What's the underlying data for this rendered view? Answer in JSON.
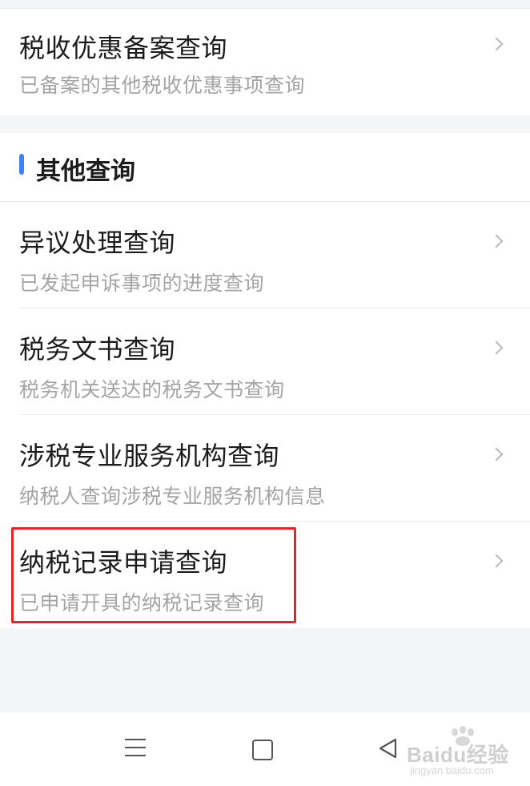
{
  "top_row": {
    "title": "税收优惠备案查询",
    "subtitle": "已备案的其他税收优惠事项查询"
  },
  "section": {
    "header": "其他查询",
    "accent_color": "#3b82f6",
    "items": [
      {
        "title": "异议处理查询",
        "subtitle": "已发起申诉事项的进度查询"
      },
      {
        "title": "税务文书查询",
        "subtitle": "税务机关送达的税务文书查询"
      },
      {
        "title": "涉税专业服务机构查询",
        "subtitle": "纳税人查询涉税专业服务机构信息"
      },
      {
        "title": "纳税记录申请查询",
        "subtitle": "已申请开具的纳税记录查询"
      }
    ]
  },
  "highlight_color": "#e5252a",
  "navbar": {
    "icons": [
      "menu-icon",
      "home-icon",
      "back-icon"
    ]
  },
  "watermark": {
    "text": "Baidu经验",
    "url": "jingyan.baidu.com"
  }
}
